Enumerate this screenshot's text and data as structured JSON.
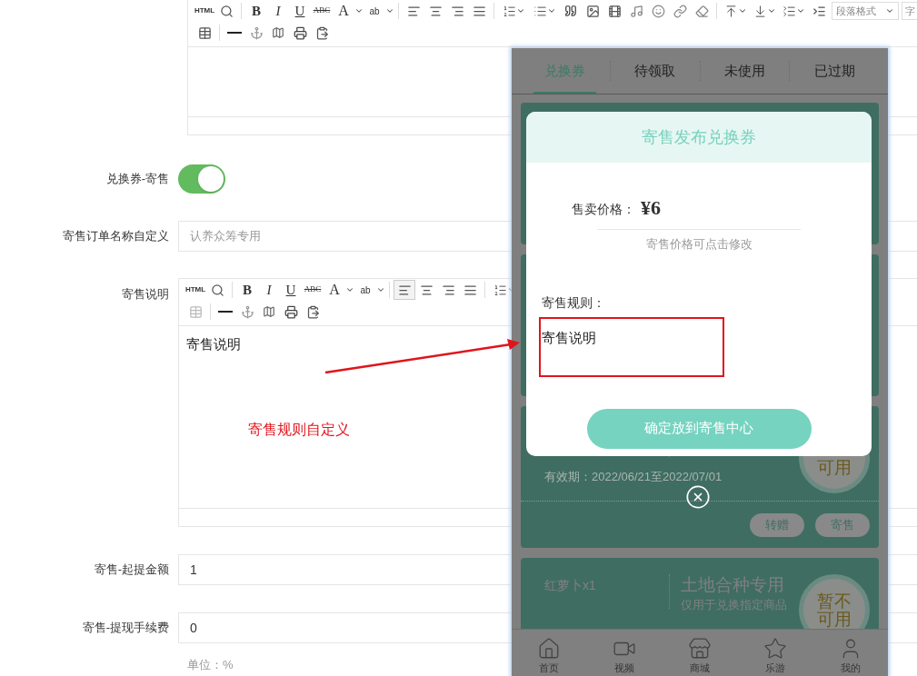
{
  "top_editor": {
    "toolbar_labels": [
      "HTML",
      "B",
      "I",
      "U",
      "ABC",
      "A",
      "ab",
      "段落格式",
      "字"
    ],
    "align_left_selected": false
  },
  "form_rows": [
    {
      "kind": "toggle",
      "label": "兑换券-寄售",
      "on": true
    },
    {
      "kind": "input",
      "label": "寄售订单名称自定义",
      "placeholder": "认养众筹专用"
    },
    {
      "kind": "editor",
      "label": "寄售说明",
      "toolbar_labels": [
        "HTML",
        "B",
        "I",
        "U",
        "ABC",
        "A",
        "ab"
      ],
      "align_left_selected": true,
      "content": "寄售说明"
    },
    {
      "kind": "input",
      "label": "寄售-起提金额",
      "value": "1"
    },
    {
      "kind": "input",
      "label": "寄售-提现手续费",
      "value": "0",
      "hint": "单位：%"
    }
  ],
  "annotation": {
    "text": "寄售规则自定义"
  },
  "phone": {
    "tabs": [
      {
        "label": "兑换券",
        "selected": true
      },
      {
        "label": "待领取",
        "selected": false
      },
      {
        "label": "未使用",
        "selected": false
      },
      {
        "label": "已过期",
        "selected": false
      }
    ],
    "coupons": [
      {
        "kind": "covered"
      },
      {
        "kind": "covered"
      },
      {
        "kind": "detail",
        "validity": "有效期：2022/06/21至2022/07/01",
        "stamp": "可用",
        "actions": [
          "转赠",
          "寄售"
        ]
      },
      {
        "kind": "detail",
        "name": "红萝卜x1",
        "title": "土地合种专用",
        "subtitle": "仅用于兑换指定商品",
        "stamp": "暂不可用"
      }
    ],
    "modal": {
      "title": "寄售发布兑换券",
      "price_label": "售卖价格：",
      "price": "¥6",
      "price_hint": "寄售价格可点击修改",
      "rules_label": "寄售规则：",
      "rules_value": "寄售说明",
      "confirm": "确定放到寄售中心"
    },
    "nav": [
      {
        "label": "首页"
      },
      {
        "label": "视频"
      },
      {
        "label": "商城"
      },
      {
        "label": "乐游"
      },
      {
        "label": "我的"
      }
    ]
  }
}
